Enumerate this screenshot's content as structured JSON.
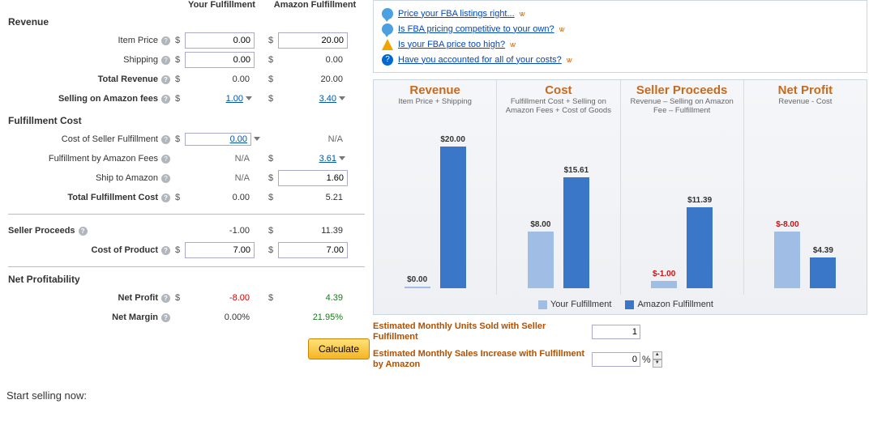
{
  "headers": {
    "yf": "Your Fulfillment",
    "af": "Amazon Fulfillment"
  },
  "sections": {
    "revenue": "Revenue",
    "fulfillment": "Fulfillment Cost",
    "profitability": "Net Profitability"
  },
  "rows": {
    "item_price": "Item Price",
    "shipping": "Shipping",
    "total_revenue": "Total Revenue",
    "selling_fees": "Selling on Amazon fees",
    "cost_seller_fulfillment": "Cost of Seller Fulfillment",
    "fba_fees": "Fulfillment by Amazon Fees",
    "ship_to_amazon": "Ship to Amazon",
    "total_fulfillment": "Total Fulfillment Cost",
    "seller_proceeds": "Seller Proceeds",
    "cost_product": "Cost of Product",
    "net_profit": "Net Profit",
    "net_margin": "Net Margin"
  },
  "vals": {
    "yf": {
      "item_price": "0.00",
      "shipping": "0.00",
      "total_revenue": "0.00",
      "selling_fees": "1.00",
      "cost_seller_fulfillment": "0.00",
      "fba_fees": "N/A",
      "ship_to_amazon": "N/A",
      "total_fulfillment": "0.00",
      "seller_proceeds": "-1.00",
      "cost_product": "7.00",
      "net_profit": "-8.00",
      "net_margin": "0.00%"
    },
    "af": {
      "item_price": "20.00",
      "shipping": "0.00",
      "total_revenue": "20.00",
      "selling_fees": "3.40",
      "cost_seller_fulfillment": "N/A",
      "fba_fees": "3.61",
      "ship_to_amazon": "1.60",
      "total_fulfillment": "5.21",
      "seller_proceeds": "11.39",
      "cost_product": "7.00",
      "net_profit": "4.39",
      "net_margin": "21.95%"
    }
  },
  "tips": [
    "Price your FBA listings right...",
    "Is FBA pricing competitive to your own?",
    "Is your FBA price too high?",
    "Have you accounted for all of your costs?"
  ],
  "chart_data": [
    {
      "type": "bar",
      "title": "Revenue",
      "subtitle": "Item Price + Shipping",
      "series": [
        {
          "name": "Your Fulfillment",
          "value": 0.0,
          "label": "$0.00"
        },
        {
          "name": "Amazon Fulfillment",
          "value": 20.0,
          "label": "$20.00"
        }
      ]
    },
    {
      "type": "bar",
      "title": "Cost",
      "subtitle": "Fulfillment Cost + Selling on Amazon Fees + Cost of Goods",
      "series": [
        {
          "name": "Your Fulfillment",
          "value": 8.0,
          "label": "$8.00"
        },
        {
          "name": "Amazon Fulfillment",
          "value": 15.61,
          "label": "$15.61"
        }
      ]
    },
    {
      "type": "bar",
      "title": "Seller Proceeds",
      "subtitle": "Revenue – Selling on Amazon Fee – Fulfillment",
      "series": [
        {
          "name": "Your Fulfillment",
          "value": -1.0,
          "label": "$-1.00"
        },
        {
          "name": "Amazon Fulfillment",
          "value": 11.39,
          "label": "$11.39"
        }
      ]
    },
    {
      "type": "bar",
      "title": "Net Profit",
      "subtitle": "Revenue - Cost",
      "series": [
        {
          "name": "Your Fulfillment",
          "value": -8.0,
          "label": "$-8.00"
        },
        {
          "name": "Amazon Fulfillment",
          "value": 4.39,
          "label": "$4.39"
        }
      ]
    }
  ],
  "legend": {
    "yf": "Your Fulfillment",
    "af": "Amazon Fulfillment"
  },
  "estimates": {
    "units_label": "Estimated Monthly Units Sold with Seller Fulfillment",
    "units_value": "1",
    "increase_label": "Estimated Monthly Sales Increase with Fulfillment by Amazon",
    "increase_value": "0",
    "increase_suffix": "%"
  },
  "calculate": "Calculate",
  "start": "Start selling now:"
}
